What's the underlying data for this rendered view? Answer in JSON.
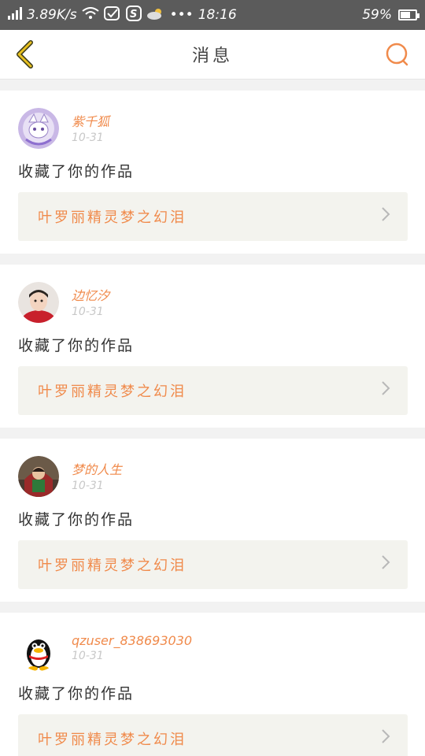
{
  "status_bar": {
    "signal_speed": "3.89K/s",
    "time": "18:16",
    "battery": "59%"
  },
  "header": {
    "title": "消息"
  },
  "colors": {
    "accent": "#f08a4b",
    "back_arrow": "#e8c020",
    "card_bg": "#ffffff",
    "work_box_bg": "#f3f3ee"
  },
  "messages": [
    {
      "username": "紫千狐",
      "date": "10-31",
      "action": "收藏了你的作品",
      "work_title": "叶罗丽精灵梦之幻泪",
      "avatar_icon": "white-fox-avatar"
    },
    {
      "username": "边忆汐",
      "date": "10-31",
      "action": "收藏了你的作品",
      "work_title": "叶罗丽精灵梦之幻泪",
      "avatar_icon": "boy-portrait-avatar"
    },
    {
      "username": "梦的人生",
      "date": "10-31",
      "action": "收藏了你的作品",
      "work_title": "叶罗丽精灵梦之幻泪",
      "avatar_icon": "child-photo-avatar"
    },
    {
      "username": "qzuser_838693030",
      "date": "10-31",
      "action": "收藏了你的作品",
      "work_title": "叶罗丽精灵梦之幻泪",
      "avatar_icon": "qq-penguin-avatar"
    }
  ]
}
